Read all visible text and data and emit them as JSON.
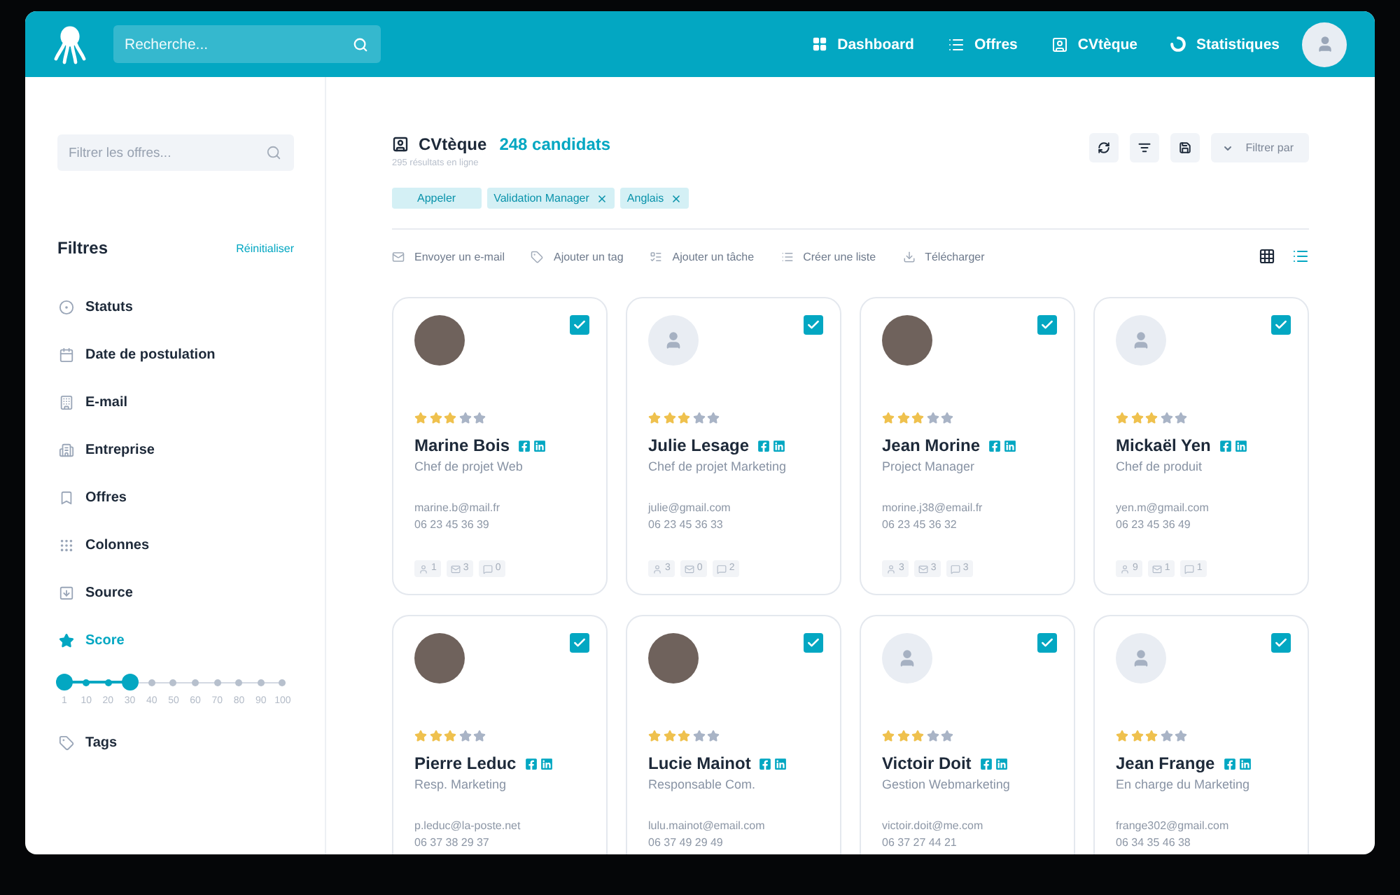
{
  "topbar": {
    "search": {
      "placeholder": "Recherche..."
    },
    "nav": [
      {
        "label": "Dashboard"
      },
      {
        "label": "Offres"
      },
      {
        "label": "CVtèque"
      },
      {
        "label": "Statistiques"
      }
    ]
  },
  "sidebar": {
    "search": {
      "placeholder": "Filtrer les offres..."
    },
    "title": "Filtres",
    "reset": "Réinitialiser",
    "items": [
      {
        "label": "Statuts",
        "expanded": false
      },
      {
        "label": "Date de postulation",
        "expanded": false
      },
      {
        "label": "E-mail",
        "expanded": false
      },
      {
        "label": "Entreprise",
        "expanded": false
      },
      {
        "label": "Offres",
        "expanded": false
      },
      {
        "label": "Colonnes",
        "expanded": false
      },
      {
        "label": "Source",
        "expanded": false
      },
      {
        "label": "Score",
        "expanded": true,
        "slider": {
          "level": 0.3,
          "ticks": [
            "1",
            "10",
            "20",
            "30",
            "40",
            "50",
            "60",
            "70",
            "80",
            "90",
            "100"
          ]
        }
      },
      {
        "label": "Tags",
        "expanded": false
      }
    ]
  },
  "main": {
    "title": "CVtèque",
    "count": "248 candidats",
    "subtitle": "295 résultats en ligne",
    "filter_button": "Filtrer par",
    "tags": [
      {
        "label": "Appeler",
        "removable": false
      },
      {
        "label": "Validation Manager",
        "removable": true
      },
      {
        "label": "Anglais",
        "removable": true
      }
    ],
    "actions": [
      "Envoyer un e-mail",
      "Ajouter un tag",
      "Ajouter un tâche",
      "Créer une liste",
      "Télécharger"
    ],
    "views": [
      {
        "kind": "grid",
        "selected": false
      },
      {
        "kind": "list",
        "selected": true
      }
    ],
    "cards": [
      {
        "name": "Marine Bois",
        "title": "Chef de projet Web",
        "email": "marine.b@mail.fr",
        "phone": "06 23 45 36 39",
        "has_photo": true,
        "stars": 3,
        "checked": true,
        "stats": [
          "1",
          "3",
          "0"
        ]
      },
      {
        "name": "Julie Lesage",
        "title": "Chef de projet Marketing",
        "email": "julie@gmail.com",
        "phone": "06 23 45 36 33",
        "has_photo": false,
        "stars": 3,
        "checked": true,
        "stats": [
          "3",
          "0",
          "2"
        ]
      },
      {
        "name": "Jean Morine",
        "title": "Project Manager",
        "email": "morine.j38@email.fr",
        "phone": "06 23 45 36 32",
        "has_photo": true,
        "stars": 3,
        "checked": true,
        "stats": [
          "3",
          "3",
          "3"
        ]
      },
      {
        "name": "Mickaël Yen",
        "title": "Chef de produit",
        "email": "yen.m@gmail.com",
        "phone": "06 23 45 36 49",
        "has_photo": false,
        "stars": 3,
        "checked": true,
        "stats": [
          "9",
          "1",
          "1"
        ]
      },
      {
        "name": "Pierre Leduc",
        "title": "Resp. Marketing",
        "email": "p.leduc@la-poste.net",
        "phone": "06 37 38 29 37",
        "has_photo": true,
        "stars": 3,
        "checked": true
      },
      {
        "name": "Lucie Mainot",
        "title": "Responsable Com.",
        "email": "lulu.mainot@email.com",
        "phone": "06 37 49 29 49",
        "has_photo": true,
        "stars": 3,
        "checked": true
      },
      {
        "name": "Victoir Doit",
        "title": "Gestion Webmarketing",
        "email": "victoir.doit@me.com",
        "phone": "06 37 27 44 21",
        "has_photo": false,
        "stars": 3,
        "checked": true
      },
      {
        "name": "Jean Frange",
        "title": "En charge du Marketing",
        "email": "frange302@gmail.com",
        "phone": "06 34 35 46 38",
        "has_photo": false,
        "stars": 3,
        "checked": true
      }
    ]
  }
}
